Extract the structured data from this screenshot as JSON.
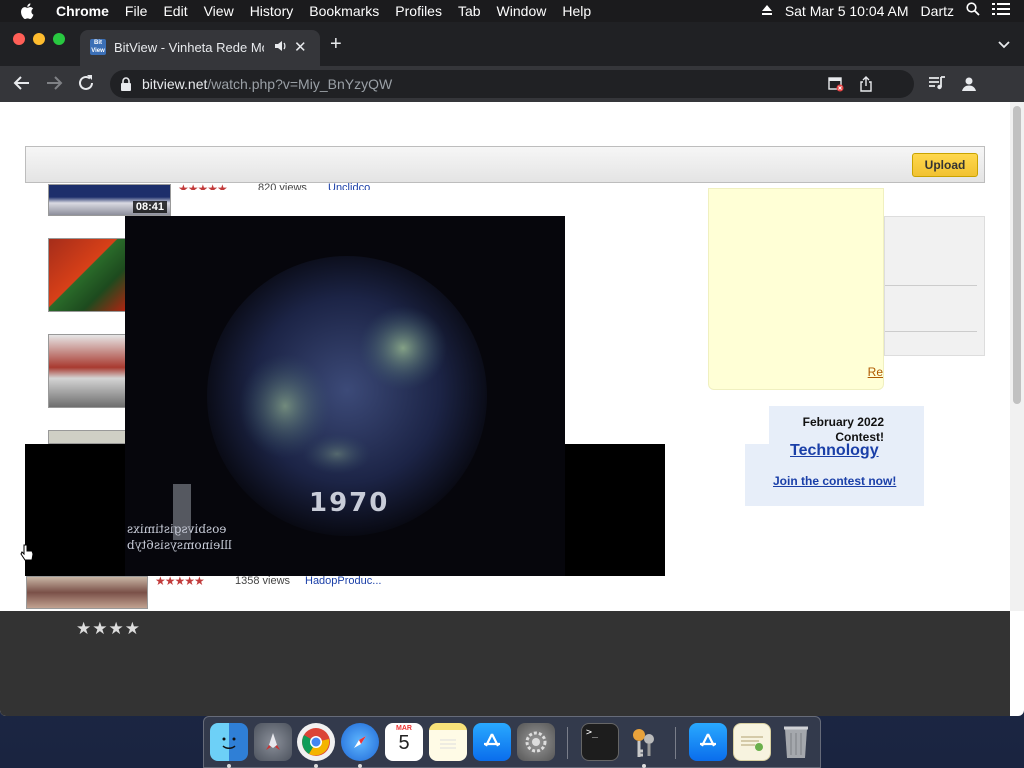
{
  "menubar": {
    "app": "Chrome",
    "items": [
      "File",
      "Edit",
      "View",
      "History",
      "Bookmarks",
      "Profiles",
      "Tab",
      "Window",
      "Help"
    ],
    "clock": "Sat Mar 5  10:04 AM",
    "user": "Dartz"
  },
  "browser": {
    "tab_title": "BitView - Vinheta Rede Mo",
    "favicon_text": "Bit View",
    "url_domain": "bitview.net",
    "url_path": "/watch.php?v=Miy_BnYzyQW"
  },
  "page": {
    "upload_label": "Upload",
    "related": [
      {
        "duration": "08:41",
        "stars": "★★★★★",
        "views": "820 views",
        "user": "Unclidco"
      },
      {
        "stars": "★★★★★",
        "views": "1358 views",
        "user": "HadopProduc..."
      }
    ],
    "ad_link": "Re",
    "contest": {
      "line1": "February 2022",
      "line2": "Contest!",
      "topic": "Technology",
      "cta": "Join the contest now!"
    },
    "video": {
      "year_text": "1970",
      "overlay_text_1": "eosbivsgistimixs",
      "overlay_text_2": "llleinomsysis6tyb"
    },
    "footer_stars": "★★★★"
  },
  "dock": {
    "apps": [
      "Finder",
      "Launchpad",
      "Google Chrome",
      "Safari",
      "Calendar",
      "Notes",
      "App Store",
      "System Preferences",
      "Terminal",
      "Keychain Access",
      "App Store",
      "Certificate Assistant",
      "Trash"
    ],
    "calendar_month": "MAR",
    "calendar_day": "5"
  }
}
